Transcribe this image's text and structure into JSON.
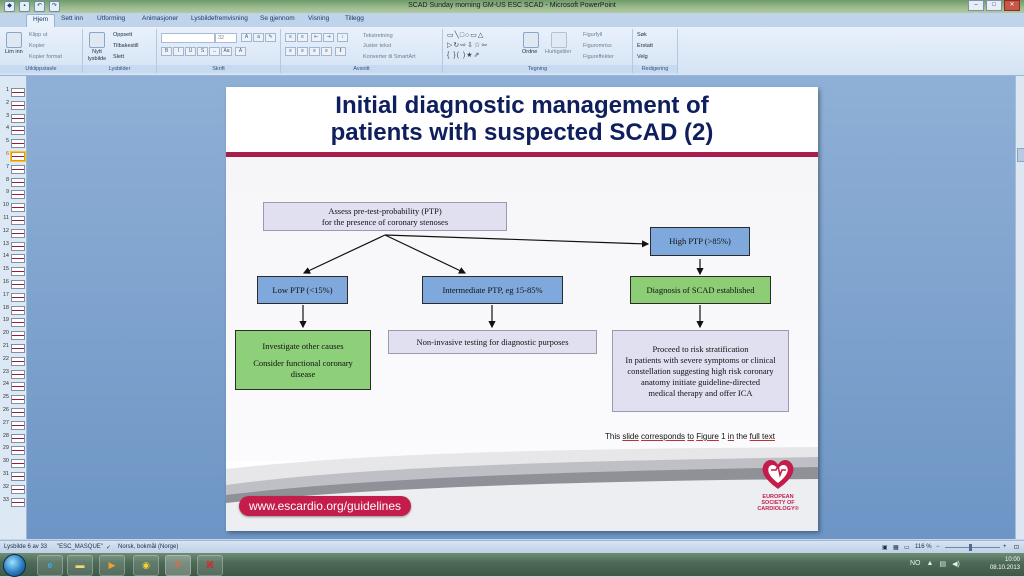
{
  "window": {
    "title": "SCAD Sunday morning GM-US ESC SCAD - Microsoft PowerPoint"
  },
  "ribbon": {
    "tabs": [
      "Hjem",
      "Sett inn",
      "Utforming",
      "Animasjoner",
      "Lysbildefremvisning",
      "Se gjennom",
      "Visning",
      "Tillegg"
    ],
    "active_tab": "Hjem",
    "clipboard": {
      "paste": "Lim inn",
      "cut": "Klipp ut",
      "copy": "Kopier",
      "format_painter": "Kopier format",
      "label": "Utklippstavle"
    },
    "slides": {
      "new_slide": "Nytt lysbilde",
      "layout": "Oppsett",
      "reset": "Tilbakestill",
      "delete": "Slett",
      "label": "Lysbilder"
    },
    "font": {
      "size": "32",
      "label": "Skrift"
    },
    "paragraph": {
      "text_direction": "Tekstretning",
      "align_text": "Juster tekst",
      "smartart": "Konverter til SmartArt",
      "label": "Avsnitt"
    },
    "drawing": {
      "arrange": "Ordne",
      "quick_styles": "Hurtigstiler",
      "fill": "Figurfyll",
      "outline": "Figuromriss",
      "effects": "Figureffekter",
      "label": "Tegning"
    },
    "editing": {
      "find": "Søk",
      "replace": "Erstatt",
      "select": "Velg",
      "label": "Redigering"
    }
  },
  "slide_pane": {
    "numbers": [
      "1",
      "2",
      "3",
      "4",
      "5",
      "6",
      "7",
      "8",
      "9",
      "10",
      "11",
      "12",
      "13",
      "14",
      "15",
      "16",
      "17",
      "18",
      "19",
      "20",
      "21",
      "22",
      "23",
      "24",
      "25",
      "26",
      "27",
      "28",
      "29",
      "30",
      "31",
      "32",
      "33"
    ],
    "current": 6
  },
  "slide": {
    "title_line1": "Initial diagnostic management of",
    "title_line2": "patients with suspected SCAD (2)",
    "boxes": {
      "assess_line1": "Assess pre-test-probability (PTP)",
      "assess_line2": "for the presence of coronary stenoses",
      "high_ptp": "High PTP (>85%)",
      "low_ptp": "Low PTP (<15%)",
      "intermediate_ptp": "Intermediate PTP, eg 15-85%",
      "diagnosis": "Diagnosis of SCAD established",
      "investigate_line1": "Investigate other causes",
      "investigate_line2": "Consider functional coronary",
      "investigate_line3": "disease",
      "noninvasive": "Non-invasive testing for diagnostic purposes",
      "proceed_line1": "Proceed to risk stratification",
      "proceed_line2": "In patients with severe symptoms or clinical",
      "proceed_line3": "constellation suggesting high risk coronary",
      "proceed_line4": "anatomy initiate guideline-directed",
      "proceed_line5": "medical therapy and offer ICA"
    },
    "footnote": {
      "p1": "This ",
      "p2": "slide",
      "p3": " ",
      "p4": "corresponds",
      "p5": " ",
      "p6": "to",
      "p7": " ",
      "p8": "Figure",
      "p9": " 1 ",
      "p10": "in",
      "p11": " the ",
      "p12": "full text"
    },
    "url": "www.escardio.org/guidelines",
    "logo_line1": "EUROPEAN",
    "logo_line2": "SOCIETY OF",
    "logo_line3": "CARDIOLOGY®"
  },
  "status": {
    "slide_counter": "Lysbilde 6 av 33",
    "theme": "\"ESC_MASQUE\"",
    "language": "Norsk, bokmål (Norge)",
    "zoom": "116 %"
  },
  "taskbar": {
    "lang": "NO",
    "time": "10:00",
    "date": "08.10.2013"
  },
  "colors": {
    "title": "#0f1e5c",
    "accent": "#a81e4c",
    "box_blue": "#7fa9dc",
    "box_green": "#8ecf7a",
    "box_lavender": "#e1e0f1"
  }
}
